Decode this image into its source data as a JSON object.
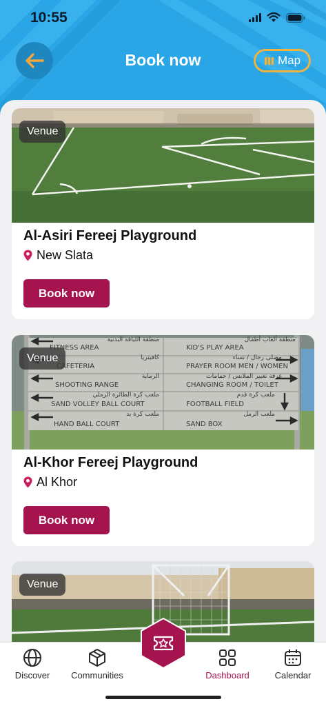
{
  "status": {
    "time": "10:55"
  },
  "header": {
    "title": "Book now",
    "map_label": "Map"
  },
  "cards": [
    {
      "badge": "Venue",
      "title": "Al-Asiri Fereej Playground",
      "location": "New Slata",
      "button": "Book now"
    },
    {
      "badge": "Venue",
      "title": "Al-Khor Fereej Playground",
      "location": "Al Khor",
      "button": "Book now"
    },
    {
      "badge": "Venue"
    }
  ],
  "signboard": {
    "rows": [
      {
        "left": "FITNESS AREA",
        "left_ar": "منطقة اللياقة البدنية",
        "right": "KID'S PLAY AREA",
        "right_ar": "منطقة ألعاب أطفال"
      },
      {
        "left": "CAFETERIA",
        "left_ar": "كافيتريا",
        "right": "PRAYER ROOM MEN / WOMEN",
        "right_ar": "مصلى رجال / نساء"
      },
      {
        "left": "SHOOTING RANGE",
        "left_ar": "الرماية",
        "right": "CHANGING ROOM / TOILET",
        "right_ar": "غرفة تغيير الملابس / حمامات"
      },
      {
        "left": "SAND VOLLEY BALL COURT",
        "left_ar": "ملعب كرة الطائرة الرملي",
        "right": "FOOTBALL FIELD",
        "right_ar": "ملعب كرة قدم"
      },
      {
        "left": "HAND BALL COURT",
        "left_ar": "ملعب كرة يد",
        "right": "SAND BOX",
        "right_ar": "ملعب الرمل"
      }
    ]
  },
  "nav": {
    "items": [
      {
        "label": "Discover",
        "icon": "globe-icon"
      },
      {
        "label": "Communities",
        "icon": "cube-icon"
      },
      {
        "label": "Dashboard",
        "icon": "grid-icon",
        "active": true
      },
      {
        "label": "Calendar",
        "icon": "calendar-icon"
      }
    ],
    "center_icon": "ticket-star-icon"
  },
  "colors": {
    "header": "#2aa6e6",
    "accent": "#a5144e",
    "map_border": "#f2b33d",
    "back_arrow": "#f2a93b"
  }
}
